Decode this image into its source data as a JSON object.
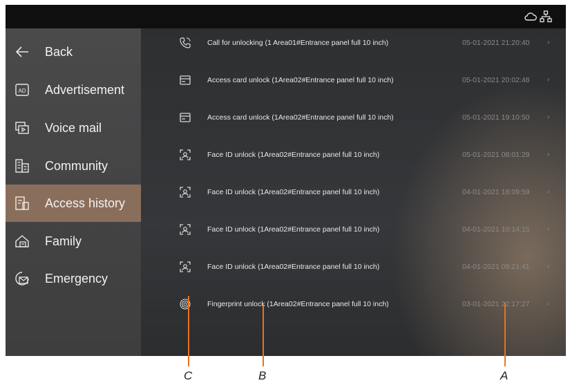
{
  "status_icons": [
    "cloud-icon",
    "network-icon"
  ],
  "sidebar": {
    "items": [
      {
        "label": "Back",
        "icon": "back-arrow-icon"
      },
      {
        "label": "Advertisement",
        "icon": "ad-icon"
      },
      {
        "label": "Voice mail",
        "icon": "voice-mail-icon"
      },
      {
        "label": "Community",
        "icon": "community-icon"
      },
      {
        "label": "Access history",
        "icon": "access-history-icon",
        "active": true
      },
      {
        "label": "Family",
        "icon": "family-icon"
      },
      {
        "label": "Emergency",
        "icon": "emergency-icon"
      }
    ]
  },
  "history": {
    "rows": [
      {
        "icon": "phone-unlock-icon",
        "text": "Call for unlocking (1 Area01#Entrance panel full 10 inch)",
        "time": "05-01-2021 21:20:40"
      },
      {
        "icon": "access-card-icon",
        "text": "Access card unlock (1Area02#Entrance panel full 10 inch)",
        "time": "05-01-2021 20:02:48"
      },
      {
        "icon": "access-card-icon",
        "text": "Access card unlock (1Area02#Entrance panel full 10 inch)",
        "time": "05-01-2021 19:10:50"
      },
      {
        "icon": "face-id-icon",
        "text": "Face ID unlock (1Area02#Entrance panel full 10 inch)",
        "time": "05-01-2021 08:01:29"
      },
      {
        "icon": "face-id-icon",
        "text": "Face ID unlock (1Area02#Entrance panel full 10 inch)",
        "time": "04-01-2021 18:09:59"
      },
      {
        "icon": "face-id-icon",
        "text": "Face ID unlock (1Area02#Entrance panel full 10 inch)",
        "time": "04-01-2021 10:14:15"
      },
      {
        "icon": "face-id-icon",
        "text": "Face ID unlock (1Area02#Entrance panel full 10 inch)",
        "time": "04-01-2021 09:21:41"
      },
      {
        "icon": "fingerprint-icon",
        "text": "Fingerprint unlock (1Area02#Entrance panel full 10 inch)",
        "time": "03-01-2021 22:17:27"
      }
    ]
  },
  "callouts": {
    "a": "A",
    "b": "B",
    "c": "C",
    "color": "#e8731e"
  }
}
